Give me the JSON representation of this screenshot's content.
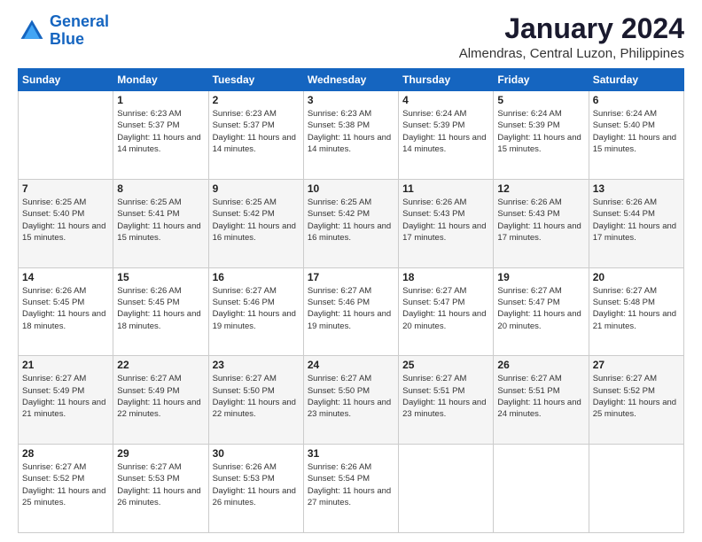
{
  "logo": {
    "line1": "General",
    "line2": "Blue"
  },
  "title": "January 2024",
  "subtitle": "Almendras, Central Luzon, Philippines",
  "weekdays": [
    "Sunday",
    "Monday",
    "Tuesday",
    "Wednesday",
    "Thursday",
    "Friday",
    "Saturday"
  ],
  "weeks": [
    [
      {
        "day": "",
        "sunrise": "",
        "sunset": "",
        "daylight": ""
      },
      {
        "day": "1",
        "sunrise": "Sunrise: 6:23 AM",
        "sunset": "Sunset: 5:37 PM",
        "daylight": "Daylight: 11 hours and 14 minutes."
      },
      {
        "day": "2",
        "sunrise": "Sunrise: 6:23 AM",
        "sunset": "Sunset: 5:37 PM",
        "daylight": "Daylight: 11 hours and 14 minutes."
      },
      {
        "day": "3",
        "sunrise": "Sunrise: 6:23 AM",
        "sunset": "Sunset: 5:38 PM",
        "daylight": "Daylight: 11 hours and 14 minutes."
      },
      {
        "day": "4",
        "sunrise": "Sunrise: 6:24 AM",
        "sunset": "Sunset: 5:39 PM",
        "daylight": "Daylight: 11 hours and 14 minutes."
      },
      {
        "day": "5",
        "sunrise": "Sunrise: 6:24 AM",
        "sunset": "Sunset: 5:39 PM",
        "daylight": "Daylight: 11 hours and 15 minutes."
      },
      {
        "day": "6",
        "sunrise": "Sunrise: 6:24 AM",
        "sunset": "Sunset: 5:40 PM",
        "daylight": "Daylight: 11 hours and 15 minutes."
      }
    ],
    [
      {
        "day": "7",
        "sunrise": "Sunrise: 6:25 AM",
        "sunset": "Sunset: 5:40 PM",
        "daylight": "Daylight: 11 hours and 15 minutes."
      },
      {
        "day": "8",
        "sunrise": "Sunrise: 6:25 AM",
        "sunset": "Sunset: 5:41 PM",
        "daylight": "Daylight: 11 hours and 15 minutes."
      },
      {
        "day": "9",
        "sunrise": "Sunrise: 6:25 AM",
        "sunset": "Sunset: 5:42 PM",
        "daylight": "Daylight: 11 hours and 16 minutes."
      },
      {
        "day": "10",
        "sunrise": "Sunrise: 6:25 AM",
        "sunset": "Sunset: 5:42 PM",
        "daylight": "Daylight: 11 hours and 16 minutes."
      },
      {
        "day": "11",
        "sunrise": "Sunrise: 6:26 AM",
        "sunset": "Sunset: 5:43 PM",
        "daylight": "Daylight: 11 hours and 17 minutes."
      },
      {
        "day": "12",
        "sunrise": "Sunrise: 6:26 AM",
        "sunset": "Sunset: 5:43 PM",
        "daylight": "Daylight: 11 hours and 17 minutes."
      },
      {
        "day": "13",
        "sunrise": "Sunrise: 6:26 AM",
        "sunset": "Sunset: 5:44 PM",
        "daylight": "Daylight: 11 hours and 17 minutes."
      }
    ],
    [
      {
        "day": "14",
        "sunrise": "Sunrise: 6:26 AM",
        "sunset": "Sunset: 5:45 PM",
        "daylight": "Daylight: 11 hours and 18 minutes."
      },
      {
        "day": "15",
        "sunrise": "Sunrise: 6:26 AM",
        "sunset": "Sunset: 5:45 PM",
        "daylight": "Daylight: 11 hours and 18 minutes."
      },
      {
        "day": "16",
        "sunrise": "Sunrise: 6:27 AM",
        "sunset": "Sunset: 5:46 PM",
        "daylight": "Daylight: 11 hours and 19 minutes."
      },
      {
        "day": "17",
        "sunrise": "Sunrise: 6:27 AM",
        "sunset": "Sunset: 5:46 PM",
        "daylight": "Daylight: 11 hours and 19 minutes."
      },
      {
        "day": "18",
        "sunrise": "Sunrise: 6:27 AM",
        "sunset": "Sunset: 5:47 PM",
        "daylight": "Daylight: 11 hours and 20 minutes."
      },
      {
        "day": "19",
        "sunrise": "Sunrise: 6:27 AM",
        "sunset": "Sunset: 5:47 PM",
        "daylight": "Daylight: 11 hours and 20 minutes."
      },
      {
        "day": "20",
        "sunrise": "Sunrise: 6:27 AM",
        "sunset": "Sunset: 5:48 PM",
        "daylight": "Daylight: 11 hours and 21 minutes."
      }
    ],
    [
      {
        "day": "21",
        "sunrise": "Sunrise: 6:27 AM",
        "sunset": "Sunset: 5:49 PM",
        "daylight": "Daylight: 11 hours and 21 minutes."
      },
      {
        "day": "22",
        "sunrise": "Sunrise: 6:27 AM",
        "sunset": "Sunset: 5:49 PM",
        "daylight": "Daylight: 11 hours and 22 minutes."
      },
      {
        "day": "23",
        "sunrise": "Sunrise: 6:27 AM",
        "sunset": "Sunset: 5:50 PM",
        "daylight": "Daylight: 11 hours and 22 minutes."
      },
      {
        "day": "24",
        "sunrise": "Sunrise: 6:27 AM",
        "sunset": "Sunset: 5:50 PM",
        "daylight": "Daylight: 11 hours and 23 minutes."
      },
      {
        "day": "25",
        "sunrise": "Sunrise: 6:27 AM",
        "sunset": "Sunset: 5:51 PM",
        "daylight": "Daylight: 11 hours and 23 minutes."
      },
      {
        "day": "26",
        "sunrise": "Sunrise: 6:27 AM",
        "sunset": "Sunset: 5:51 PM",
        "daylight": "Daylight: 11 hours and 24 minutes."
      },
      {
        "day": "27",
        "sunrise": "Sunrise: 6:27 AM",
        "sunset": "Sunset: 5:52 PM",
        "daylight": "Daylight: 11 hours and 25 minutes."
      }
    ],
    [
      {
        "day": "28",
        "sunrise": "Sunrise: 6:27 AM",
        "sunset": "Sunset: 5:52 PM",
        "daylight": "Daylight: 11 hours and 25 minutes."
      },
      {
        "day": "29",
        "sunrise": "Sunrise: 6:27 AM",
        "sunset": "Sunset: 5:53 PM",
        "daylight": "Daylight: 11 hours and 26 minutes."
      },
      {
        "day": "30",
        "sunrise": "Sunrise: 6:26 AM",
        "sunset": "Sunset: 5:53 PM",
        "daylight": "Daylight: 11 hours and 26 minutes."
      },
      {
        "day": "31",
        "sunrise": "Sunrise: 6:26 AM",
        "sunset": "Sunset: 5:54 PM",
        "daylight": "Daylight: 11 hours and 27 minutes."
      },
      {
        "day": "",
        "sunrise": "",
        "sunset": "",
        "daylight": ""
      },
      {
        "day": "",
        "sunrise": "",
        "sunset": "",
        "daylight": ""
      },
      {
        "day": "",
        "sunrise": "",
        "sunset": "",
        "daylight": ""
      }
    ]
  ]
}
